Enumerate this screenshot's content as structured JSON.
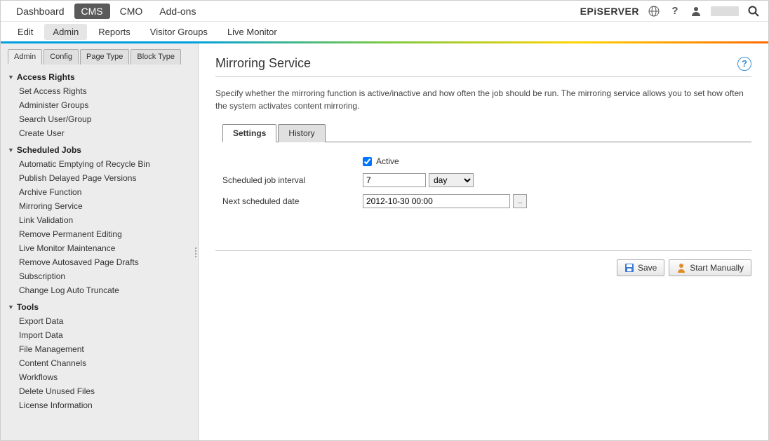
{
  "topNav": {
    "items": [
      "Dashboard",
      "CMS",
      "CMO",
      "Add-ons"
    ],
    "activeIndex": 1
  },
  "logo": "EPiSERVER",
  "subNav": {
    "items": [
      "Edit",
      "Admin",
      "Reports",
      "Visitor Groups",
      "Live Monitor"
    ],
    "activeIndex": 1
  },
  "sideTabs": {
    "items": [
      "Admin",
      "Config",
      "Page Type",
      "Block Type"
    ],
    "activeIndex": 0
  },
  "tree": [
    {
      "title": "Access Rights",
      "items": [
        "Set Access Rights",
        "Administer Groups",
        "Search User/Group",
        "Create User"
      ]
    },
    {
      "title": "Scheduled Jobs",
      "items": [
        "Automatic Emptying of Recycle Bin",
        "Publish Delayed Page Versions",
        "Archive Function",
        "Mirroring Service",
        "Link Validation",
        "Remove Permanent Editing",
        "Live Monitor Maintenance",
        "Remove Autosaved Page Drafts",
        "Subscription",
        "Change Log Auto Truncate"
      ]
    },
    {
      "title": "Tools",
      "items": [
        "Export Data",
        "Import Data",
        "File Management",
        "Content Channels",
        "Workflows",
        "Delete Unused Files",
        "License Information"
      ]
    }
  ],
  "page": {
    "title": "Mirroring Service",
    "description": "Specify whether the mirroring function is active/inactive and how often the job should be run. The mirroring service allows you to set how often the system activates content mirroring.",
    "tabs": [
      "Settings",
      "History"
    ],
    "activeTab": 0
  },
  "form": {
    "activeLabel": "Active",
    "activeChecked": true,
    "intervalLabel": "Scheduled job interval",
    "intervalValue": "7",
    "intervalUnit": "day",
    "intervalOptions": [
      "day"
    ],
    "nextDateLabel": "Next scheduled date",
    "nextDateValue": "2012-10-30 00:00"
  },
  "actions": {
    "save": "Save",
    "startManually": "Start Manually"
  }
}
